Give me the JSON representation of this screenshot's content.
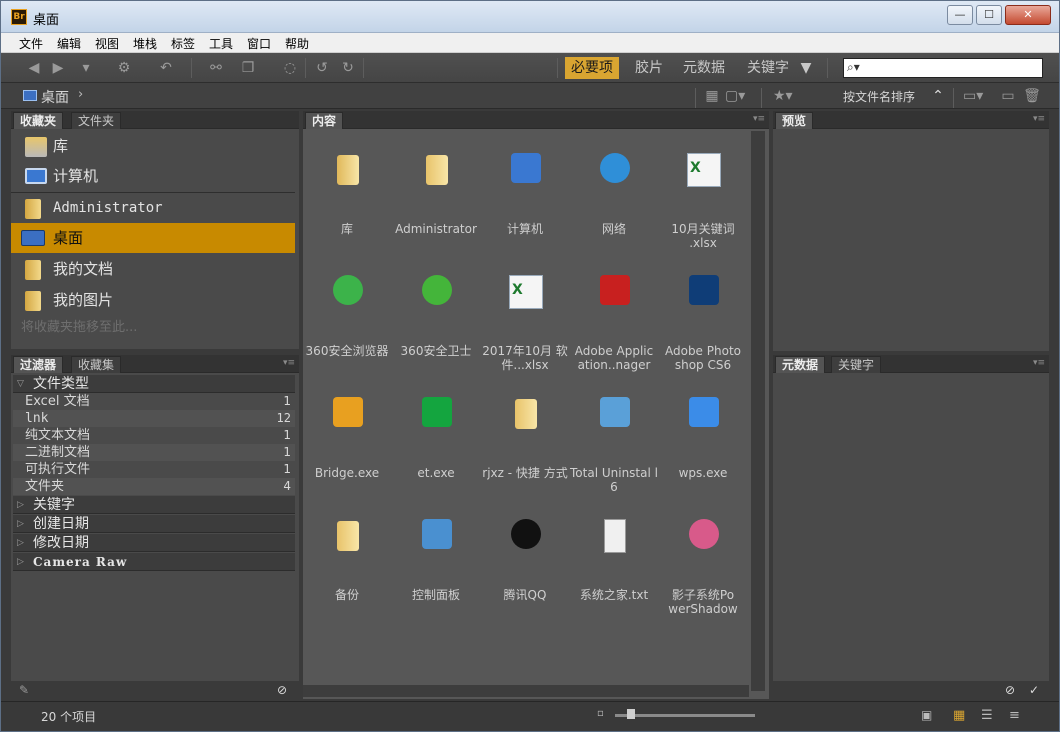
{
  "window": {
    "title": "桌面",
    "app_icon_label": "Br",
    "min": "—",
    "max": "☐",
    "close": "✕"
  },
  "menu": [
    "文件",
    "编辑",
    "视图",
    "堆栈",
    "标签",
    "工具",
    "窗口",
    "帮助"
  ],
  "workspaces": [
    "必要项",
    "胶片",
    "元数据",
    "关键字"
  ],
  "active_workspace": "必要项",
  "path": {
    "current": "桌面"
  },
  "sort_label": "按文件名排序",
  "panels": {
    "favorites_tabs": [
      "收藏夹",
      "文件夹"
    ],
    "favorites": [
      {
        "label": "库",
        "icon": "library-icon"
      },
      {
        "label": "计算机",
        "icon": "computer-icon"
      },
      {
        "label": "Administrator",
        "icon": "user-folder-icon"
      },
      {
        "label": "桌面",
        "icon": "desktop-icon",
        "selected": true
      },
      {
        "label": "我的文档",
        "icon": "documents-folder-icon"
      },
      {
        "label": "我的图片",
        "icon": "pictures-folder-icon"
      }
    ],
    "favorites_hint": "将收藏夹拖移至此...",
    "filter_tabs": [
      "过滤器",
      "收藏集"
    ],
    "filter_groups": [
      {
        "name": "文件类型",
        "expanded": true,
        "rows": [
          {
            "label": "Excel 文档",
            "count": "1"
          },
          {
            "label": "lnk",
            "count": "12"
          },
          {
            "label": "纯文本文档",
            "count": "1"
          },
          {
            "label": "二进制文档",
            "count": "1"
          },
          {
            "label": "可执行文件",
            "count": "1"
          },
          {
            "label": "文件夹",
            "count": "4"
          }
        ]
      },
      {
        "name": "关键字",
        "expanded": false
      },
      {
        "name": "创建日期",
        "expanded": false
      },
      {
        "name": "修改日期",
        "expanded": false
      },
      {
        "name": "Camera Raw",
        "expanded": false
      }
    ],
    "content_tab": "内容",
    "preview_tab": "预览",
    "metadata_tabs": [
      "元数据",
      "关键字"
    ]
  },
  "content_items": [
    {
      "label": "库",
      "icon": "library-icon",
      "color": "#e0b85a"
    },
    {
      "label": "Administrator",
      "icon": "folder-icon",
      "color": "#e8c36a"
    },
    {
      "label": "计算机",
      "icon": "computer-icon",
      "color": "#3a78d1"
    },
    {
      "label": "网络",
      "icon": "network-icon",
      "color": "#2f8fd8"
    },
    {
      "label": "10月关键词 .xlsx",
      "icon": "excel-file-icon",
      "color": "#1e7a2e"
    },
    {
      "label": "360安全浏览器",
      "icon": "360-browser-icon",
      "color": "#3cb34a"
    },
    {
      "label": "360安全卫士",
      "icon": "360-guard-icon",
      "color": "#44b53a"
    },
    {
      "label": "2017年10月 软件...xlsx",
      "icon": "excel-file-icon",
      "color": "#1e7a2e"
    },
    {
      "label": "Adobe Applic ation..nager",
      "icon": "adobe-app-manager-icon",
      "color": "#c8201f"
    },
    {
      "label": "Adobe Photo shop CS6",
      "icon": "photoshop-icon",
      "color": "#0f3d77"
    },
    {
      "label": "Bridge.exe",
      "icon": "bridge-icon",
      "color": "#e8a020"
    },
    {
      "label": "et.exe",
      "icon": "wps-spreadsheet-icon",
      "color": "#14a53f"
    },
    {
      "label": "rjxz - 快捷 方式",
      "icon": "folder-shortcut-icon",
      "color": "#e8c36a"
    },
    {
      "label": "Total Uninstal l 6",
      "icon": "total-uninstall-icon",
      "color": "#5aa0d8"
    },
    {
      "label": "wps.exe",
      "icon": "wps-writer-icon",
      "color": "#3b8ce8"
    },
    {
      "label": "备份",
      "icon": "folder-icon",
      "color": "#e8c36a"
    },
    {
      "label": "控制面板",
      "icon": "control-panel-icon",
      "color": "#4a90d0"
    },
    {
      "label": "腾讯QQ",
      "icon": "qq-icon",
      "color": "#111111"
    },
    {
      "label": "系统之家.txt",
      "icon": "text-file-icon",
      "color": "#f0f0f0"
    },
    {
      "label": "影子系统Po werShadow",
      "icon": "powershadow-icon",
      "color": "#d85a8a"
    }
  ],
  "status": {
    "count_text": "20 个项目"
  }
}
